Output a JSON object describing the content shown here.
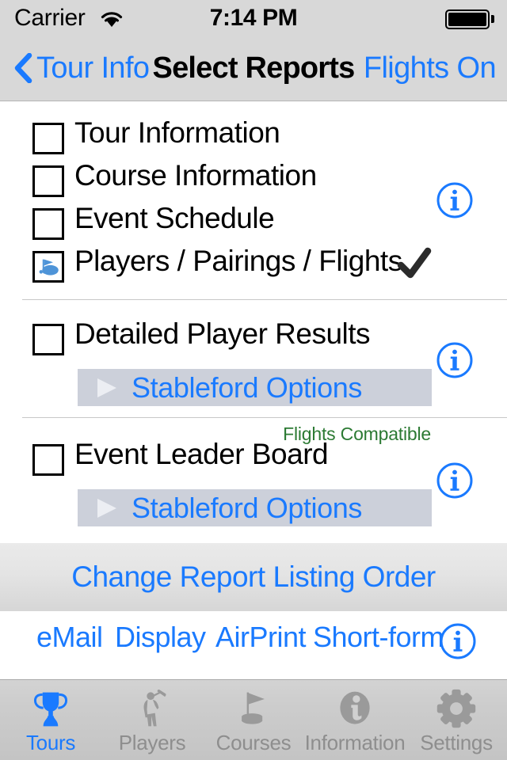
{
  "status_bar": {
    "carrier": "Carrier",
    "wifi_icon": "wifi-icon",
    "time": "7:14 PM",
    "battery_icon": "battery-full-icon"
  },
  "nav_bar": {
    "back_icon": "chevron-left-icon",
    "back_label": "Tour Info",
    "title": "Select Reports",
    "right_label": "Flights On"
  },
  "report_section_one": {
    "items": [
      {
        "label": "Tour Information",
        "checked": false,
        "icon": "empty-checkbox-icon",
        "checkmark": ""
      },
      {
        "label": "Course Information",
        "checked": false,
        "icon": "empty-checkbox-icon",
        "checkmark": ""
      },
      {
        "label": "Event Schedule",
        "checked": false,
        "icon": "empty-checkbox-icon",
        "checkmark": ""
      },
      {
        "label": "Players / Pairings / Flights",
        "checked": true,
        "icon": "golf-course-icon",
        "checkmark": "✔"
      }
    ],
    "info_icon": "info-icon"
  },
  "report_section_two": {
    "label": "Detailed Player Results",
    "checked": false,
    "options_label": "Stableford Options",
    "disclosure_icon": "triangle-right-icon",
    "info_icon": "info-icon"
  },
  "report_section_three": {
    "compatible_note": "Flights Compatible",
    "label": "Event Leader Board",
    "checked": false,
    "options_label": "Stableford Options",
    "disclosure_icon": "triangle-right-icon",
    "info_icon": "info-icon"
  },
  "order_bar": {
    "label": "Change Report Listing Order"
  },
  "action_row": {
    "actions": [
      "eMail",
      "Display",
      "AirPrint",
      "Short-form"
    ],
    "info_icon": "info-icon"
  },
  "tab_bar": {
    "tabs": [
      {
        "label": "Tours",
        "icon": "trophy-icon",
        "active": true
      },
      {
        "label": "Players",
        "icon": "golfer-icon",
        "active": false
      },
      {
        "label": "Courses",
        "icon": "flag-green-icon",
        "active": false
      },
      {
        "label": "Information",
        "icon": "info-circle-icon",
        "active": false
      },
      {
        "label": "Settings",
        "icon": "gear-icon",
        "active": false
      }
    ]
  },
  "colors": {
    "accent_blue": "#1a7aff",
    "green_note": "#2c7a33",
    "bar_grey": "#d8d8d8",
    "option_bar_grey": "#ccd0da",
    "inactive_tab": "#8e8e8e"
  }
}
